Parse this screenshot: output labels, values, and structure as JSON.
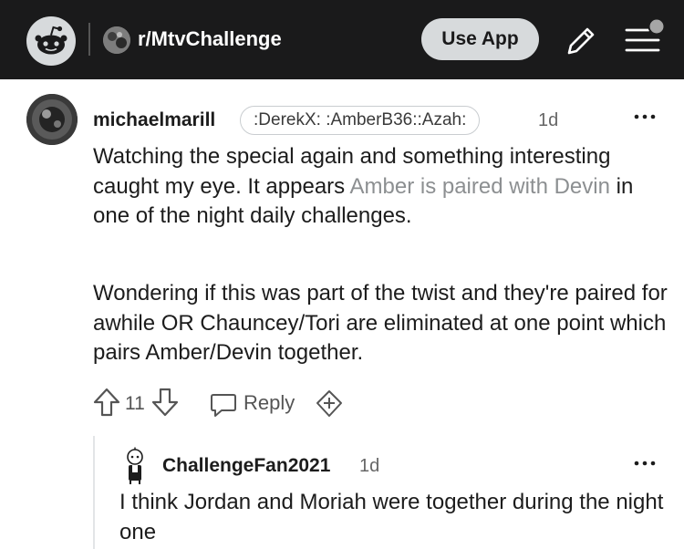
{
  "header": {
    "subreddit": "r/MtvChallenge",
    "use_app_label": "Use App",
    "colors": {
      "bar": "#1a1a1b",
      "button": "#d7dadc"
    }
  },
  "comments": [
    {
      "username": "michaelmarill",
      "flair": ":DerekX: :AmberB36::Azah:",
      "time": "1d",
      "paragraph1_before": "Watching the special again and something interesting caught my eye. It appears ",
      "paragraph1_link": "Amber is paired with Devin",
      "paragraph1_after": " in one of the night daily challenges.",
      "paragraph2": "Wondering if this was part of the twist and they're paired for awhile OR Chauncey/Tori are eliminated at one point which pairs Amber/Devin together.",
      "score": "11",
      "reply_label": "Reply"
    },
    {
      "username": "ChallengeFan2021",
      "time": "1d",
      "text": "I think Jordan and Moriah were together during the night one"
    }
  ],
  "icons": [
    "reddit-logo-icon",
    "pencil-icon",
    "menu-icon",
    "more-icon",
    "upvote-icon",
    "downvote-icon",
    "reply-icon",
    "award-icon"
  ]
}
